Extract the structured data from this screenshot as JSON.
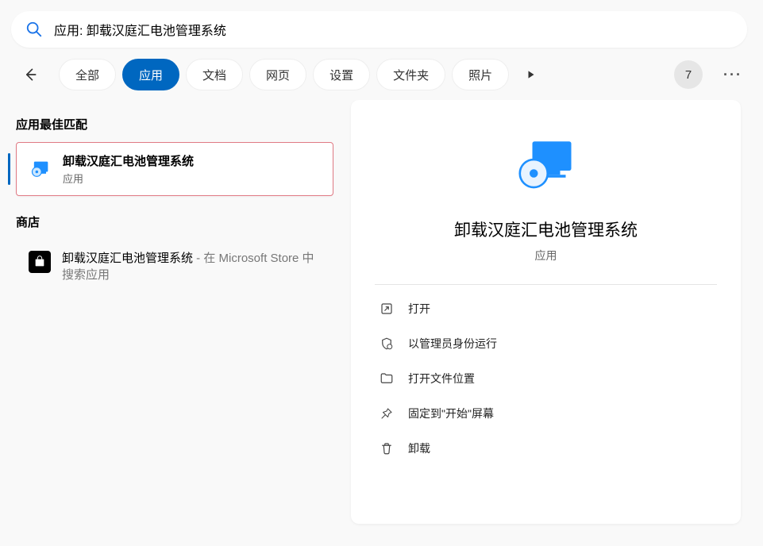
{
  "search": {
    "value": "应用: 卸载汉庭汇电池管理系统"
  },
  "filters": {
    "all": "全部",
    "apps": "应用",
    "documents": "文档",
    "web": "网页",
    "settings": "设置",
    "folders": "文件夹",
    "photos": "照片"
  },
  "count_badge": "7",
  "left": {
    "best_match_header": "应用最佳匹配",
    "best_match": {
      "title": "卸载汉庭汇电池管理系统",
      "subtitle": "应用"
    },
    "store_header": "商店",
    "store_item": {
      "title": "卸载汉庭汇电池管理系统",
      "suffix": " - 在 Microsoft Store 中搜索应用"
    }
  },
  "detail": {
    "title": "卸载汉庭汇电池管理系统",
    "subtitle": "应用",
    "actions": {
      "open": "打开",
      "run_admin": "以管理员身份运行",
      "open_location": "打开文件位置",
      "pin_start": "固定到\"开始\"屏幕",
      "uninstall": "卸载"
    }
  }
}
